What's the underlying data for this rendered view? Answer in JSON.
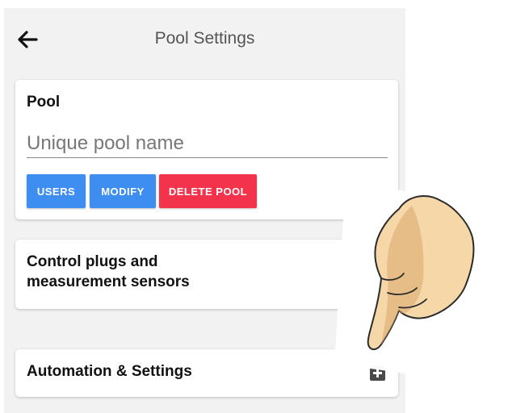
{
  "header": {
    "title": "Pool Settings",
    "back_icon": "arrow-left-icon"
  },
  "pool_card": {
    "title": "Pool",
    "name_input": {
      "value": "",
      "placeholder": "Unique pool name"
    },
    "buttons": {
      "users": "USERS",
      "modify": "MODIFY",
      "delete": "DELETE POOL"
    }
  },
  "plugs_card": {
    "title": "Control plugs and measurement sensors"
  },
  "automation_card": {
    "title": "Automation & Settings",
    "add_icon": "plus-square-icon"
  },
  "colors": {
    "primary_button": "#3d8ef0",
    "danger_button": "#f2334b",
    "background": "#f2f2f2"
  }
}
